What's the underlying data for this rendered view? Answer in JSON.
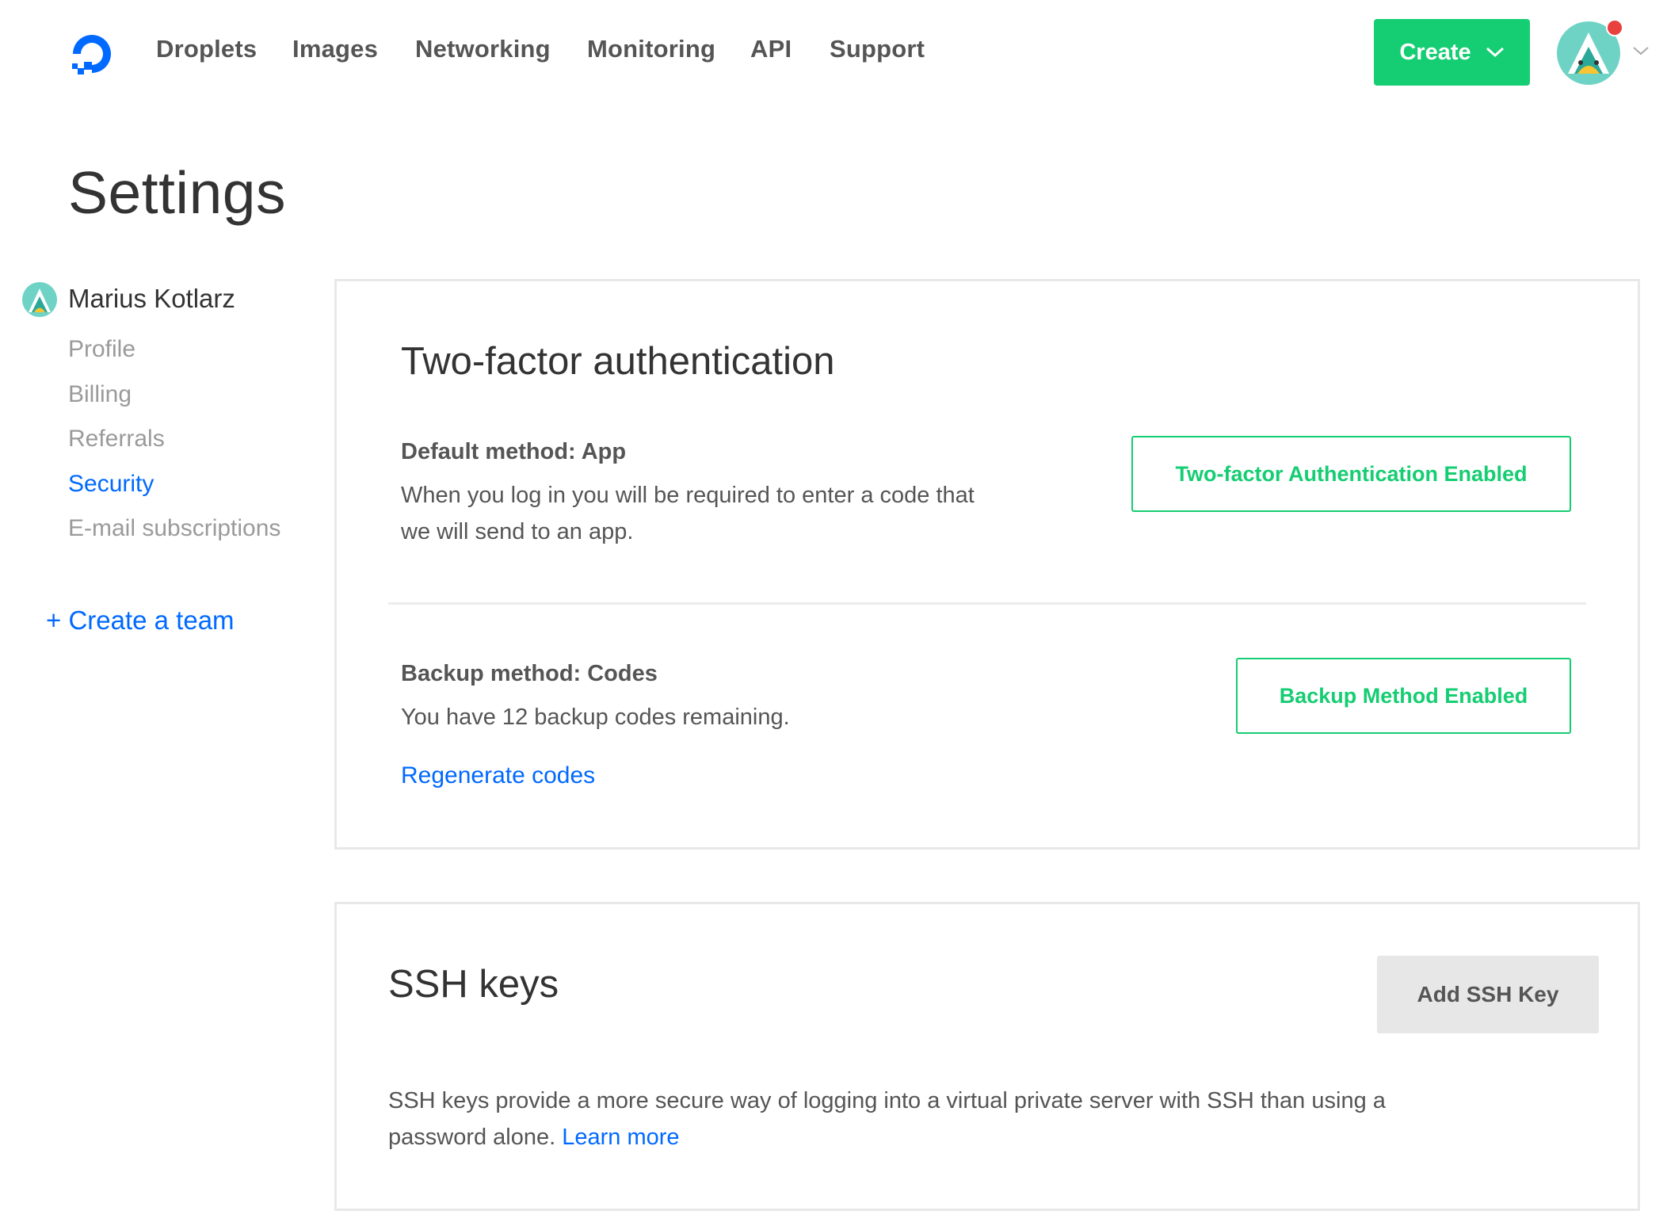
{
  "nav": {
    "items": [
      {
        "label": "Droplets"
      },
      {
        "label": "Images"
      },
      {
        "label": "Networking"
      },
      {
        "label": "Monitoring"
      },
      {
        "label": "API"
      },
      {
        "label": "Support"
      }
    ],
    "create_label": "Create"
  },
  "page": {
    "title": "Settings"
  },
  "sidebar": {
    "user_name": "Marius Kotlarz",
    "items": [
      {
        "label": "Profile",
        "active": false
      },
      {
        "label": "Billing",
        "active": false
      },
      {
        "label": "Referrals",
        "active": false
      },
      {
        "label": "Security",
        "active": true
      },
      {
        "label": "E-mail subscriptions",
        "active": false
      }
    ],
    "create_team": "+ Create a team"
  },
  "two_factor": {
    "title": "Two-factor authentication",
    "default_method_label": "Default method: App",
    "default_method_desc_1": "When you log in you will be required to enter a code that",
    "default_method_desc_2": "we will send to an app.",
    "enabled_button": "Two-factor Authentication Enabled",
    "backup_method_label": "Backup method: Codes",
    "backup_desc": "You have 12 backup codes remaining.",
    "regenerate_link": "Regenerate codes",
    "backup_button": "Backup Method Enabled"
  },
  "ssh": {
    "title": "SSH keys",
    "add_button": "Add SSH Key",
    "desc_1": "SSH keys provide a more secure way of logging into a virtual private server with SSH than using a",
    "desc_2": "password alone.",
    "learn_more": "Learn more"
  },
  "colors": {
    "brand_blue": "#0069ff",
    "brand_green": "#15cd72",
    "notification_red": "#e8413e"
  }
}
